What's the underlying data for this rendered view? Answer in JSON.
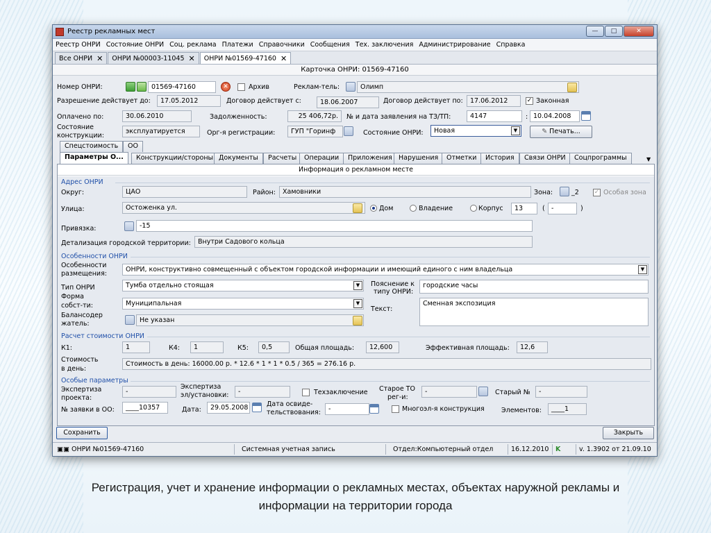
{
  "window": {
    "title": "Реестр рекламных мест",
    "buttons": {
      "minimize": "—",
      "maximize": "□",
      "close": "✕"
    }
  },
  "menu": [
    "Реестр ОНРИ",
    "Состояние ОНРИ",
    "Соц. реклама",
    "Платежи",
    "Справочники",
    "Сообщения",
    "Тех. заключения",
    "Администрирование",
    "Справка"
  ],
  "doc_tabs": [
    {
      "label": "Все ОНРИ",
      "close": "✕"
    },
    {
      "label": "ОНРИ №00003-11045",
      "close": "✕"
    },
    {
      "label": "ОНРИ №01569-47160",
      "close": "✕"
    }
  ],
  "card_title": "Карточка ОНРИ: 01569-47160",
  "header": {
    "num_label": "Номер ОНРИ:",
    "num_value": "01569-47160",
    "archive_label": "Архив",
    "advertiser_label": "Реклам-тель:",
    "advertiser_value": "Олимп",
    "permit_label": "Разрешение действует до:",
    "permit_value": "17.05.2012",
    "contract_from_label": "Договор действует с:",
    "contract_from_value": "18.06.2007",
    "contract_to_label": "Договор действует по:",
    "contract_to_value": "17.06.2012",
    "legal_label": "Законная",
    "paid_label": "Оплачено по:",
    "paid_value": "30.06.2010",
    "debt_label": "Задолженность:",
    "debt_value": "25 406,72р.",
    "app_label": "№ и дата заявления на ТЗ/ТП:",
    "app_num": "4147",
    "app_sep": ":",
    "app_date": "10.04.2008",
    "state_constr_label1": "Состояние",
    "state_constr_label2": "конструкции:",
    "state_constr_value": "эксплуатируется",
    "reg_org_label": "Орг-я регистрации:",
    "reg_org_value": "ГУП \"Горинф",
    "state_label": "Состояние ОНРИ:",
    "state_value": "Новая",
    "print_label": "Печать..."
  },
  "tabs_top": [
    "Спецстоимость",
    "ОО"
  ],
  "tabs": [
    "Параметры О...",
    "Конструкции/стороны",
    "Документы",
    "Расчеты",
    "Операции",
    "Приложения",
    "Нарушения",
    "Отметки",
    "История",
    "Связи ОНРИ",
    "Соцпрограммы"
  ],
  "panel_title": "Информация о  рекламном месте",
  "address": {
    "section": "Адрес ОНРИ",
    "district_label": "Округ:",
    "district_value": "ЦАО",
    "area_label": "Район:",
    "area_value": "Хамовники",
    "zone_label": "Зона:",
    "zone_value": "_2",
    "special_zone_label": "Особая зона",
    "street_label": "Улица:",
    "street_value": "Остоженка ул.",
    "house_label": "Дом",
    "possession_label": "Владение",
    "building_label": "Корпус",
    "house_num": "13",
    "paren_open": "(",
    "dash_value": "-",
    "paren_close": ")",
    "binding_label": "Привязка:",
    "binding_value": "-15",
    "detail_label": "Детализация городской территории:",
    "detail_value": "Внутри Садового кольца"
  },
  "features": {
    "section": "Особенности ОНРИ",
    "placement_label1": "Особенности",
    "placement_label2": "размещения:",
    "placement_value": "ОНРИ, конструктивно совмещенный с объектом городской информации и имеющий единого с ним владельца",
    "type_label": "Тип ОНРИ",
    "type_value": "Тумба отдельно стоящая",
    "type_expl_label1": "Пояснение к",
    "type_expl_label2": "типу ОНРИ:",
    "type_expl_value": "городские часы",
    "ownership_label1": "Форма",
    "ownership_label2": "собст-ти:",
    "ownership_value": "Муниципальная",
    "text_label": "Текст:",
    "text_value": "Сменная экспозиция",
    "holder_label1": "Балансодер",
    "holder_label2": "жатель:",
    "holder_value": "Не указан"
  },
  "cost": {
    "section": "Расчет стоимости ОНРИ",
    "k1_label": "К1:",
    "k1_value": "1",
    "k4_label": "К4:",
    "k4_value": "1",
    "k5_label": "К5:",
    "k5_value": "0,5",
    "total_area_label": "Общая площадь:",
    "total_area_value": "12,600",
    "eff_area_label": "Эффективная площадь:",
    "eff_area_value": "12,6",
    "cost_label1": "Стоимость",
    "cost_label2": "в день:",
    "cost_value": "Стоимость в день: 16000.00 р. * 12.6 * 1 * 1 * 0.5 / 365 = 276.16 р."
  },
  "special": {
    "section": "Особые параметры",
    "expert_label1": "Экспертиза",
    "expert_label2": "проекта:",
    "expert_value": "-",
    "expert_el_label1": "Экспертиза",
    "expert_el_label2": "эл/установки:",
    "expert_el_value": "-",
    "tech_label": "Техзаключение",
    "old_to_label1": "Старое ТО",
    "old_to_label2": "рег-и:",
    "old_to_value": "-",
    "old_num_label": "Старый №",
    "old_num_value": "-",
    "req_label": "№ заявки в ОО:",
    "req_value": "____10357",
    "date_label": "Дата:",
    "date_value": "29.05.2008",
    "survey_label1": "Дата освиде-",
    "survey_label2": "тельствования:",
    "survey_value": "-",
    "multi_label": "Многоэл-я конструкция",
    "elements_label": "Элементов:",
    "elements_value": "____1"
  },
  "buttons": {
    "save": "Сохранить",
    "close": "Закрыть"
  },
  "status": {
    "doc": "ОНРИ №01569-47160",
    "account": "Системная учетная запись",
    "dept": "Отдел:Компьютерный отдел",
    "date": "16.12.2010",
    "k": "K",
    "version": "v. 1.3902 от 21.09.10"
  },
  "caption": [
    "Регистрация, учет и хранение информации о рекламных местах, объектах наружной рекламы и",
    "информации на территории города"
  ],
  "colors": {
    "section": "#1f4fa8",
    "status_k": "#2e8b2e"
  }
}
